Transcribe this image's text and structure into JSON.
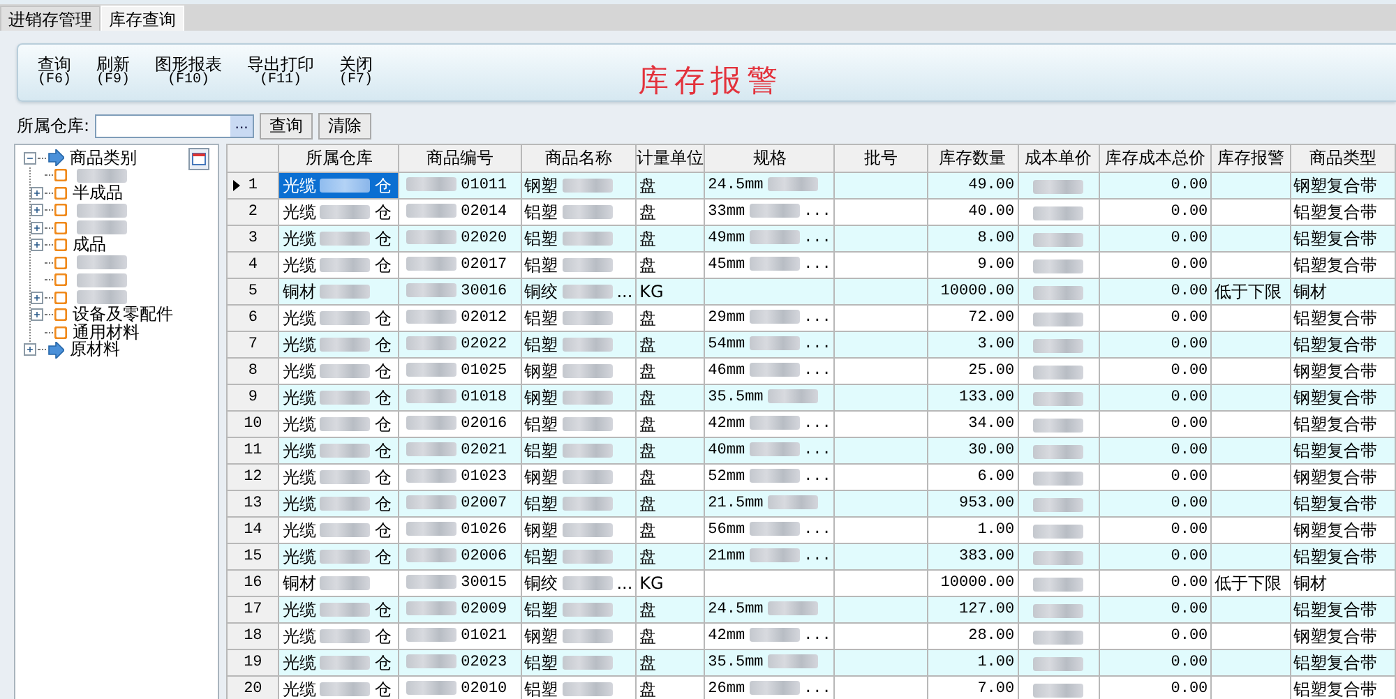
{
  "tabs": [
    {
      "label": "进销存管理",
      "selected": false
    },
    {
      "label": "库存查询",
      "selected": true
    }
  ],
  "toolbar": {
    "buttons": [
      {
        "label": "查询",
        "key": "(F6)"
      },
      {
        "label": "刷新",
        "key": "(F9)"
      },
      {
        "label": "图形报表",
        "key": "(F10)"
      },
      {
        "label": "导出打印",
        "key": "(F11)"
      },
      {
        "label": "关闭",
        "key": "(F7)"
      }
    ],
    "title": "库存报警"
  },
  "filter": {
    "label": "所属仓库:",
    "picker": "...",
    "actions": [
      "查询",
      "清除"
    ]
  },
  "tree": [
    {
      "label": "商品类别",
      "kind": "group",
      "expanded": true,
      "children": [
        {
          "kind": "item"
        },
        {
          "label": "半成品",
          "kind": "item",
          "expanded": false
        },
        {
          "kind": "item",
          "expanded": false
        },
        {
          "kind": "item",
          "expanded": false
        },
        {
          "label": "成品",
          "kind": "item",
          "expanded": false
        },
        {
          "kind": "item"
        },
        {
          "kind": "item"
        },
        {
          "kind": "item",
          "expanded": false
        },
        {
          "label": "设备及零配件",
          "kind": "item",
          "expanded": false
        },
        {
          "label": "通用材料",
          "kind": "item"
        }
      ]
    },
    {
      "label": "原材料",
      "kind": "group",
      "expanded": false
    }
  ],
  "table": {
    "columns": [
      "所属仓库",
      "商品编号",
      "商品名称",
      "计量单位",
      "规格",
      "批号",
      "库存数量",
      "成本单价",
      "库存成本总价",
      "库存报警",
      "商品类型"
    ],
    "rows": [
      {
        "number": "1",
        "selected": true,
        "warehouse": [
          "光缆",
          "仓"
        ],
        "code": [
          "01011"
        ],
        "name": [
          "钢塑"
        ],
        "unit": "盘",
        "spec": [
          "24.5mm"
        ],
        "qty": "49.00",
        "total_cost": "0.00",
        "type": "钢塑复合带"
      },
      {
        "number": "2",
        "selected": false,
        "warehouse": [
          "光缆",
          "仓"
        ],
        "code": [
          "02014"
        ],
        "name": [
          "铝塑"
        ],
        "unit": "盘",
        "spec": [
          "33mm",
          "..."
        ],
        "qty": "40.00",
        "total_cost": "0.00",
        "type": "铝塑复合带"
      },
      {
        "number": "3",
        "selected": false,
        "warehouse": [
          "光缆",
          "仓"
        ],
        "code": [
          "02020"
        ],
        "name": [
          "铝塑"
        ],
        "unit": "盘",
        "spec": [
          "49mm",
          "..."
        ],
        "qty": "8.00",
        "total_cost": "0.00",
        "type": "铝塑复合带"
      },
      {
        "number": "4",
        "selected": false,
        "warehouse": [
          "光缆",
          "仓"
        ],
        "code": [
          "02017"
        ],
        "name": [
          "铝塑"
        ],
        "unit": "盘",
        "spec": [
          "45mm",
          "..."
        ],
        "qty": "9.00",
        "total_cost": "0.00",
        "type": "铝塑复合带"
      },
      {
        "number": "5",
        "selected": false,
        "warehouse": [
          "铜材"
        ],
        "code": [
          "30016"
        ],
        "name": [
          "铜绞",
          "..."
        ],
        "unit": "KG",
        "qty": "10000.00",
        "total_cost": "0.00",
        "alarm": "低于下限",
        "type": "铜材"
      },
      {
        "number": "6",
        "selected": false,
        "warehouse": [
          "光缆",
          "仓"
        ],
        "code": [
          "02012"
        ],
        "name": [
          "铝塑"
        ],
        "unit": "盘",
        "spec": [
          "29mm",
          "..."
        ],
        "qty": "72.00",
        "total_cost": "0.00",
        "type": "铝塑复合带"
      },
      {
        "number": "7",
        "selected": false,
        "warehouse": [
          "光缆",
          "仓"
        ],
        "code": [
          "02022"
        ],
        "name": [
          "铝塑"
        ],
        "unit": "盘",
        "spec": [
          "54mm",
          "..."
        ],
        "qty": "3.00",
        "total_cost": "0.00",
        "type": "铝塑复合带"
      },
      {
        "number": "8",
        "selected": false,
        "warehouse": [
          "光缆",
          "仓"
        ],
        "code": [
          "01025"
        ],
        "name": [
          "钢塑"
        ],
        "unit": "盘",
        "spec": [
          "46mm",
          "..."
        ],
        "qty": "25.00",
        "total_cost": "0.00",
        "type": "钢塑复合带"
      },
      {
        "number": "9",
        "selected": false,
        "warehouse": [
          "光缆",
          "仓"
        ],
        "code": [
          "01018"
        ],
        "name": [
          "钢塑"
        ],
        "unit": "盘",
        "spec": [
          "35.5mm"
        ],
        "qty": "133.00",
        "total_cost": "0.00",
        "type": "钢塑复合带"
      },
      {
        "number": "10",
        "selected": false,
        "warehouse": [
          "光缆",
          "仓"
        ],
        "code": [
          "02016"
        ],
        "name": [
          "铝塑"
        ],
        "unit": "盘",
        "spec": [
          "42mm",
          "..."
        ],
        "qty": "34.00",
        "total_cost": "0.00",
        "type": "铝塑复合带"
      },
      {
        "number": "11",
        "selected": false,
        "warehouse": [
          "光缆",
          "仓"
        ],
        "code": [
          "02021"
        ],
        "name": [
          "铝塑"
        ],
        "unit": "盘",
        "spec": [
          "40mm",
          "..."
        ],
        "qty": "30.00",
        "total_cost": "0.00",
        "type": "铝塑复合带"
      },
      {
        "number": "12",
        "selected": false,
        "warehouse": [
          "光缆",
          "仓"
        ],
        "code": [
          "01023"
        ],
        "name": [
          "钢塑"
        ],
        "unit": "盘",
        "spec": [
          "52mm",
          "..."
        ],
        "qty": "6.00",
        "total_cost": "0.00",
        "type": "钢塑复合带"
      },
      {
        "number": "13",
        "selected": false,
        "warehouse": [
          "光缆",
          "仓"
        ],
        "code": [
          "02007"
        ],
        "name": [
          "铝塑"
        ],
        "unit": "盘",
        "spec": [
          "21.5mm"
        ],
        "qty": "953.00",
        "total_cost": "0.00",
        "type": "铝塑复合带"
      },
      {
        "number": "14",
        "selected": false,
        "warehouse": [
          "光缆",
          "仓"
        ],
        "code": [
          "01026"
        ],
        "name": [
          "钢塑"
        ],
        "unit": "盘",
        "spec": [
          "56mm",
          "..."
        ],
        "qty": "1.00",
        "total_cost": "0.00",
        "type": "钢塑复合带"
      },
      {
        "number": "15",
        "selected": false,
        "warehouse": [
          "光缆",
          "仓"
        ],
        "code": [
          "02006"
        ],
        "name": [
          "铝塑"
        ],
        "unit": "盘",
        "spec": [
          "21mm",
          "..."
        ],
        "qty": "383.00",
        "total_cost": "0.00",
        "type": "铝塑复合带"
      },
      {
        "number": "16",
        "selected": false,
        "warehouse": [
          "铜材"
        ],
        "code": [
          "30015"
        ],
        "name": [
          "铜绞",
          "..."
        ],
        "unit": "KG",
        "qty": "10000.00",
        "total_cost": "0.00",
        "alarm": "低于下限",
        "type": "铜材"
      },
      {
        "number": "17",
        "selected": false,
        "warehouse": [
          "光缆",
          "仓"
        ],
        "code": [
          "02009"
        ],
        "name": [
          "铝塑"
        ],
        "unit": "盘",
        "spec": [
          "24.5mm"
        ],
        "qty": "127.00",
        "total_cost": "0.00",
        "type": "铝塑复合带"
      },
      {
        "number": "18",
        "selected": false,
        "warehouse": [
          "光缆",
          "仓"
        ],
        "code": [
          "01021"
        ],
        "name": [
          "钢塑"
        ],
        "unit": "盘",
        "spec": [
          "42mm",
          "..."
        ],
        "qty": "28.00",
        "total_cost": "0.00",
        "type": "钢塑复合带"
      },
      {
        "number": "19",
        "selected": false,
        "warehouse": [
          "光缆",
          "仓"
        ],
        "code": [
          "02023"
        ],
        "name": [
          "铝塑"
        ],
        "unit": "盘",
        "spec": [
          "35.5mm"
        ],
        "qty": "1.00",
        "total_cost": "0.00",
        "type": "铝塑复合带"
      },
      {
        "number": "20",
        "selected": false,
        "warehouse": [
          "光缆",
          "仓"
        ],
        "code": [
          "02010"
        ],
        "name": [
          "铝塑"
        ],
        "unit": "盘",
        "spec": [
          "26mm",
          "..."
        ],
        "qty": "7.00",
        "total_cost": "0.00",
        "type": "铝塑复合带"
      }
    ]
  }
}
